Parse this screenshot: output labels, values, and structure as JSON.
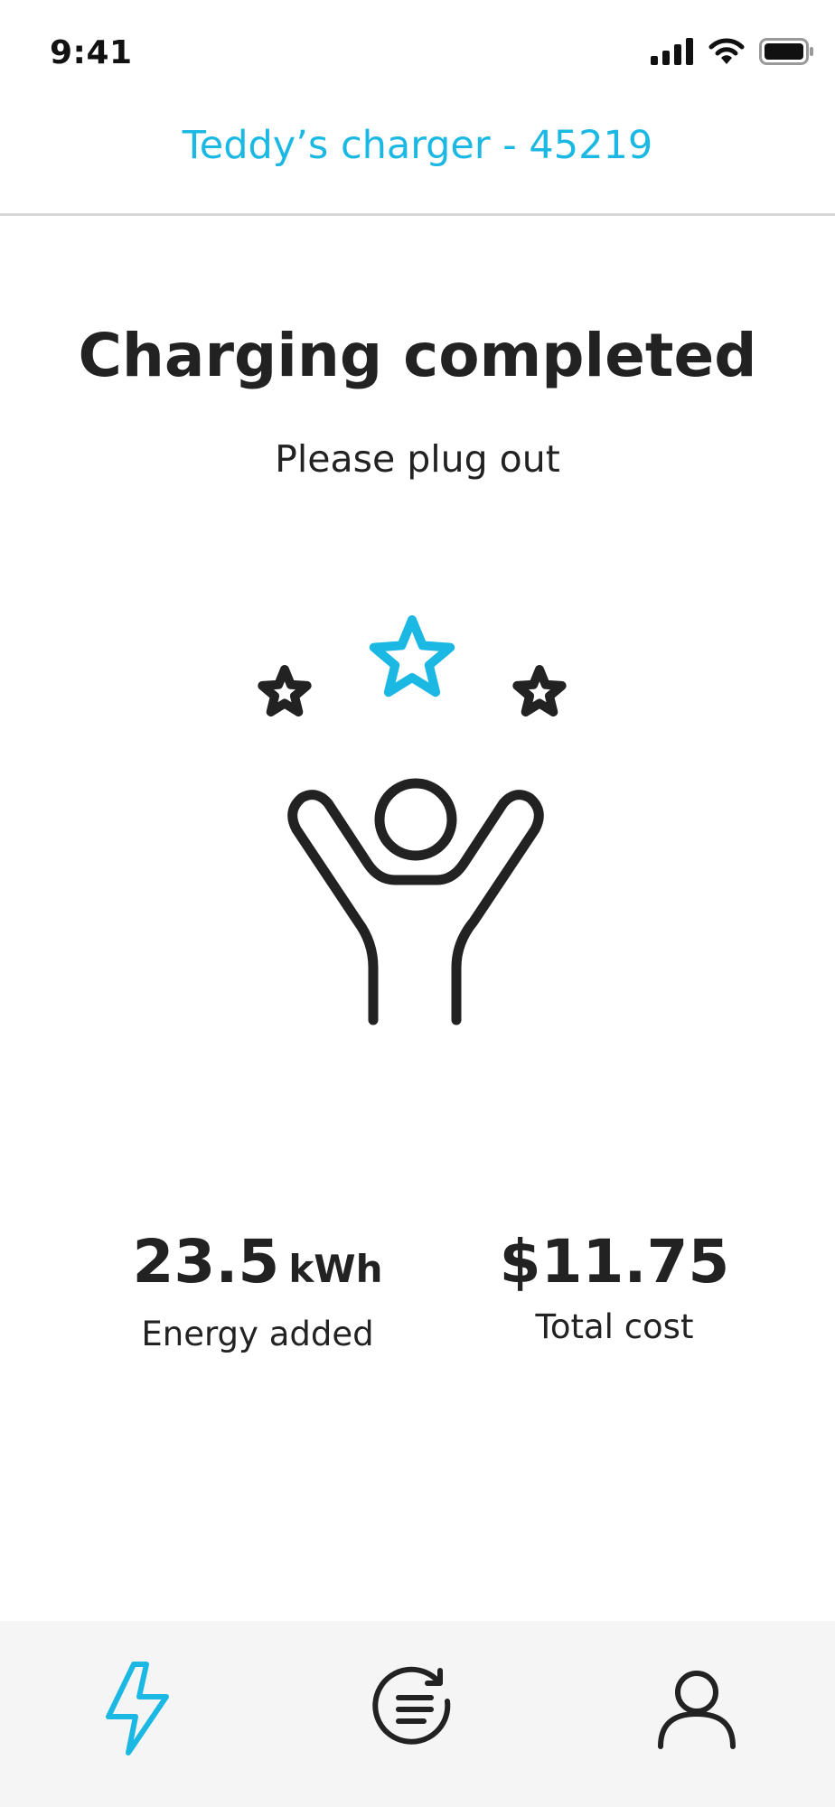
{
  "status_bar": {
    "time": "9:41",
    "icons": [
      "signal-icon",
      "wifi-icon",
      "battery-icon"
    ]
  },
  "header": {
    "title": "Teddy’s charger - 45219",
    "accent_color": "#1ab8e3"
  },
  "main": {
    "title": "Charging completed",
    "subtitle": "Please plug out",
    "illustration": "celebrating-person-with-stars-icon"
  },
  "stats": {
    "energy": {
      "value": "23.5",
      "unit": "kWh",
      "label": "Energy added"
    },
    "cost": {
      "value": "$11.75",
      "label": "Total cost"
    }
  },
  "tabbar": {
    "background": "#f5f5f5",
    "tabs": [
      {
        "icon": "lightning-icon",
        "active": true
      },
      {
        "icon": "history-icon",
        "active": false
      },
      {
        "icon": "profile-icon",
        "active": false
      }
    ]
  }
}
